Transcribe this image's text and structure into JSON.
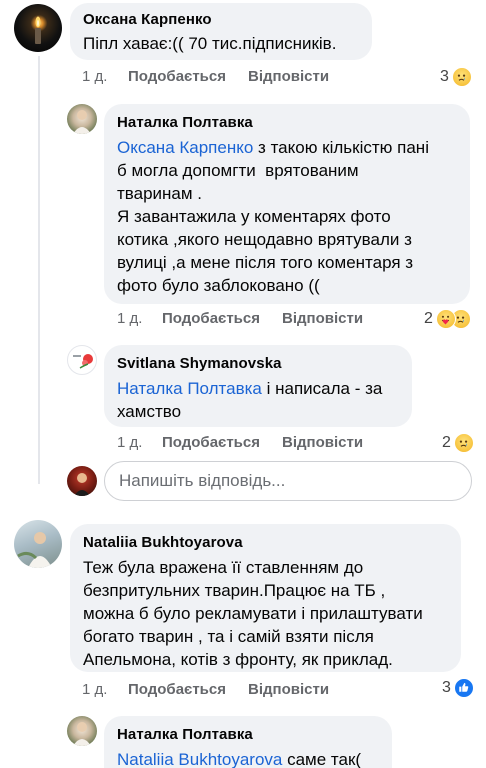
{
  "comments": [
    {
      "author": "Оксана Карпенко",
      "text": "Піпл хаває:(( 70 тис.підписників.",
      "time": "1 д.",
      "like_label": "Подобається",
      "reply_label": "Відповісти",
      "reaction_count": "3"
    },
    {
      "author": "Наталка Полтавка",
      "mention": "Оксана Карпенко",
      "text_line1_rest": " з такою кількістю пані",
      "text_rest": "б могла допомгти  врятованим\nтваринам .\nЯ завантажила у коментарях фото\nкотика ,якого нещодавно врятували з\nвулиці ,а мене після того коментаря з\nфото було заблоковано ((",
      "time": "1 д.",
      "like_label": "Подобається",
      "reply_label": "Відповісти",
      "reaction_count": "2"
    },
    {
      "author": "Svitlana Shymanovska",
      "mention": "Наталка Полтавка",
      "text_line1_rest": " і написала - за",
      "text_rest": "хамство",
      "time": "1 д.",
      "like_label": "Подобається",
      "reply_label": "Відповісти",
      "reaction_count": "2"
    },
    {
      "author": "Nataliia Bukhtoyarova",
      "text": "Теж була вражена її ставленням до\nбезпритульних тварин.Працює на ТБ ,\nможна б було рекламувати і прилаштувати\nбогато тварин , та і самій взяти після\nАпельмона, котів з фронту, як приклад.",
      "time": "1 д.",
      "like_label": "Подобається",
      "reply_label": "Відповісти",
      "reaction_count": "3"
    },
    {
      "author": "Наталка Полтавка",
      "mention": "Nataliia Bukhtoyarova",
      "text_line1_rest": " саме так("
    }
  ],
  "reply_input": {
    "placeholder": "Напишіть відповідь..."
  },
  "colors": {
    "bubble_bg": "#f0f2f5",
    "mention": "#1b64d4",
    "meta": "#65676b",
    "like_blue": "#1877f2"
  },
  "icons": {
    "reaction_sad": "sad-emoji-icon",
    "reaction_care": "care-emoji-icon",
    "reaction_like": "like-icon"
  }
}
